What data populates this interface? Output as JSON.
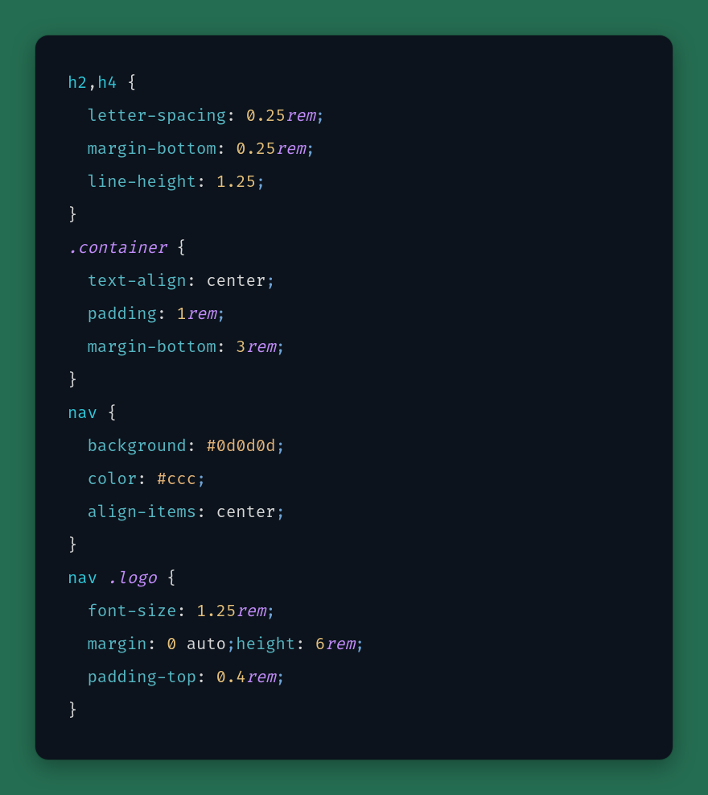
{
  "code": {
    "language": "css",
    "rules": [
      {
        "selector_parts": [
          {
            "text": "h2",
            "kind": "selector"
          },
          {
            "text": ",",
            "kind": "punct"
          },
          {
            "text": "h4",
            "kind": "selector"
          }
        ],
        "declarations": [
          {
            "property": "letter-spacing",
            "value": [
              {
                "text": "0.25",
                "kind": "num"
              },
              {
                "text": "rem",
                "kind": "unit"
              }
            ]
          },
          {
            "property": "margin-bottom",
            "value": [
              {
                "text": "0.25",
                "kind": "num"
              },
              {
                "text": "rem",
                "kind": "unit"
              }
            ]
          },
          {
            "property": "line-height",
            "value": [
              {
                "text": "1.25",
                "kind": "num"
              }
            ]
          }
        ]
      },
      {
        "selector_parts": [
          {
            "text": ".container",
            "kind": "class"
          }
        ],
        "declarations": [
          {
            "property": "text-align",
            "value": [
              {
                "text": "center",
                "kind": "value"
              }
            ]
          },
          {
            "property": "padding",
            "value": [
              {
                "text": "1",
                "kind": "num"
              },
              {
                "text": "rem",
                "kind": "unit"
              }
            ]
          },
          {
            "property": "margin-bottom",
            "value": [
              {
                "text": "3",
                "kind": "num"
              },
              {
                "text": "rem",
                "kind": "unit"
              }
            ]
          }
        ]
      },
      {
        "selector_parts": [
          {
            "text": "nav",
            "kind": "selector"
          }
        ],
        "declarations": [
          {
            "property": "background",
            "value": [
              {
                "text": "#0d0d0d",
                "kind": "ident"
              }
            ]
          },
          {
            "property": "color",
            "value": [
              {
                "text": "#ccc",
                "kind": "ident"
              }
            ]
          },
          {
            "property": "align-items",
            "value": [
              {
                "text": "center",
                "kind": "value"
              }
            ]
          }
        ]
      },
      {
        "selector_parts": [
          {
            "text": "nav",
            "kind": "selector"
          },
          {
            "text": " ",
            "kind": "space"
          },
          {
            "text": ".logo",
            "kind": "class"
          }
        ],
        "declarations": [
          {
            "property": "font-size",
            "value": [
              {
                "text": "1.25",
                "kind": "num"
              },
              {
                "text": "rem",
                "kind": "unit"
              }
            ]
          },
          {
            "property": "margin",
            "value": [
              {
                "text": "0",
                "kind": "num"
              },
              {
                "text": " ",
                "kind": "space"
              },
              {
                "text": "auto",
                "kind": "value"
              }
            ],
            "inline_extra": {
              "property": "height",
              "value": [
                {
                  "text": "6",
                  "kind": "num"
                },
                {
                  "text": "rem",
                  "kind": "unit"
                }
              ]
            }
          },
          {
            "property": "padding-top",
            "value": [
              {
                "text": "0.4",
                "kind": "num"
              },
              {
                "text": "rem",
                "kind": "unit"
              }
            ]
          }
        ]
      }
    ]
  }
}
